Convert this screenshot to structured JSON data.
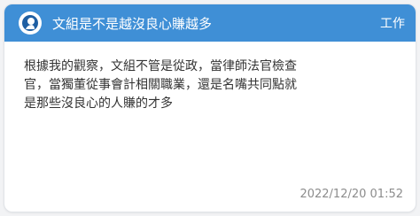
{
  "post": {
    "title": "文組是不是越沒良心賺越多",
    "board": "工作",
    "content": "根據我的觀察，文組不管是從政，當律師法官檢查官，當獨董從事會計相關職業，還是名嘴共同點就是那些沒良心的人賺的才多",
    "timestamp": "2022/12/20 01:52"
  },
  "icons": {
    "avatar": "anonymous-user-icon"
  },
  "colors": {
    "header_bg": "#3f8fd6",
    "header_text": "#ffffff",
    "body_text": "#333333",
    "timestamp": "#8c8c8c"
  }
}
